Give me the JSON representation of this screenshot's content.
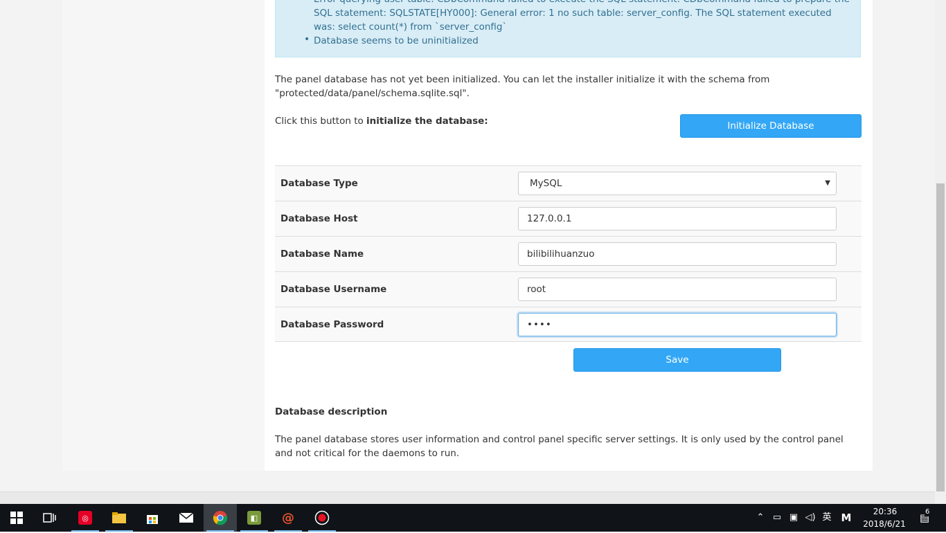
{
  "alert": {
    "items": [
      "Error querying user table: CDbCommand failed to execute the SQL statement: CDbCommand failed to prepare the SQL statement: SQLSTATE[HY000]: General error: 1 no such table: server_config. The SQL statement executed was: select count(*) from `server_config`",
      "Database seems to be uninitialized"
    ]
  },
  "intro": {
    "text": "The panel database has not yet been initialized. You can let the installer initialize it with the schema from \"protected/data/panel/schema.sqlite.sql\"."
  },
  "init": {
    "prefix": "Click this button to ",
    "bold": "initialize the database:",
    "button": "Initialize Database"
  },
  "form": {
    "type_label": "Database Type",
    "type_value": "MySQL",
    "host_label": "Database Host",
    "host_value": "127.0.0.1",
    "name_label": "Database Name",
    "name_value": "bilibilihuanzuo",
    "user_label": "Database Username",
    "user_value": "root",
    "pass_label": "Database Password",
    "pass_value": "••••",
    "save": "Save"
  },
  "description": {
    "title": "Database description",
    "body": "The panel database stores user information and control panel specific server settings. It is only used by the control panel and not critical for the daemons to run."
  },
  "taskbar": {
    "apps": [
      "netease-music-icon",
      "file-explorer-icon",
      "store-icon",
      "mail-icon",
      "chrome-icon",
      "game-icon",
      "snail-icon",
      "record-icon"
    ],
    "tray": {
      "ime": "英",
      "m_icon": "M",
      "time": "20:36",
      "date": "2018/6/21",
      "notifications": "6"
    }
  }
}
